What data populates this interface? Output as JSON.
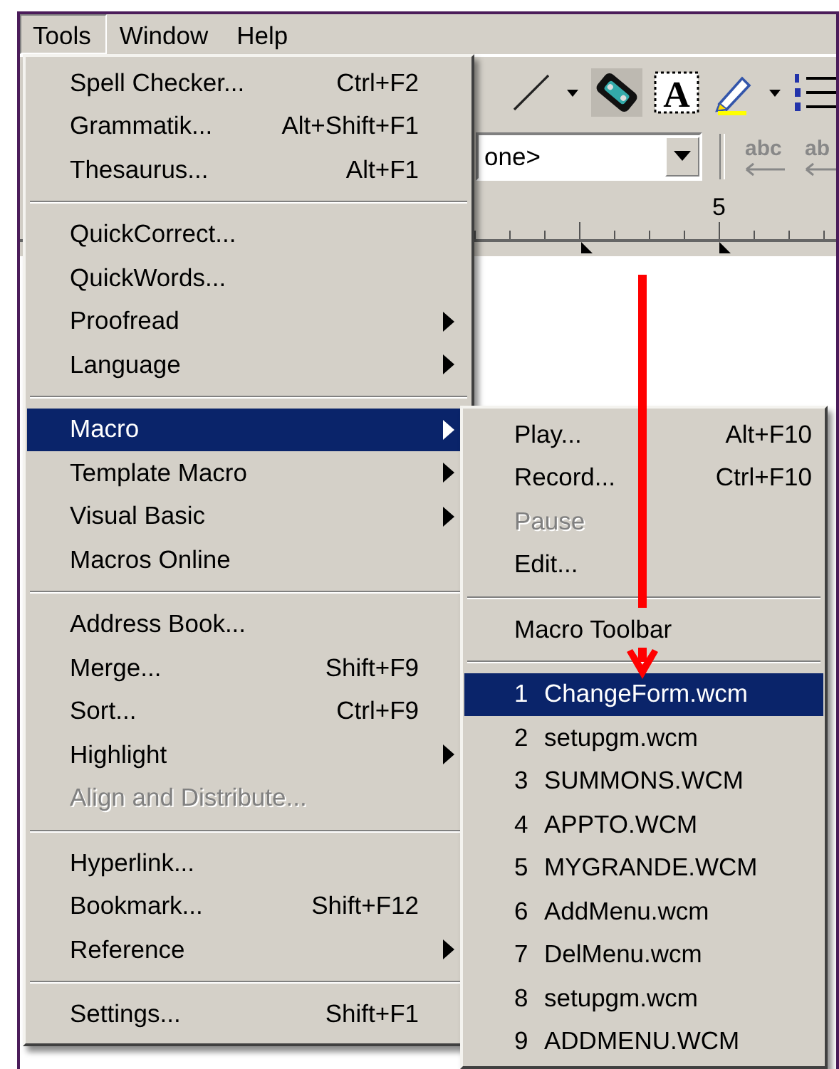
{
  "menubar": [
    {
      "label": "Tools",
      "selected": true
    },
    {
      "label": "Window",
      "selected": false
    },
    {
      "label": "Help",
      "selected": false
    }
  ],
  "toolbar": {
    "text_box_glyph": "A",
    "combo_value": "one>",
    "icon_labels": [
      "abc",
      "ab"
    ]
  },
  "ruler": {
    "labels": [
      "5"
    ]
  },
  "tools_menu": {
    "items": [
      {
        "kind": "item",
        "label": "Spell Checker...",
        "shortcut": "Ctrl+F2",
        "submenu": false,
        "disabled": false,
        "selected": false
      },
      {
        "kind": "item",
        "label": "Grammatik...",
        "shortcut": "Alt+Shift+F1",
        "submenu": false,
        "disabled": false,
        "selected": false
      },
      {
        "kind": "item",
        "label": "Thesaurus...",
        "shortcut": "Alt+F1",
        "submenu": false,
        "disabled": false,
        "selected": false
      },
      {
        "kind": "separator"
      },
      {
        "kind": "item",
        "label": "QuickCorrect...",
        "submenu": false,
        "disabled": false,
        "selected": false
      },
      {
        "kind": "item",
        "label": "QuickWords...",
        "submenu": false,
        "disabled": false,
        "selected": false
      },
      {
        "kind": "item",
        "label": "Proofread",
        "submenu": true,
        "disabled": false,
        "selected": false
      },
      {
        "kind": "item",
        "label": "Language",
        "submenu": true,
        "disabled": false,
        "selected": false
      },
      {
        "kind": "separator"
      },
      {
        "kind": "item",
        "label": "Macro",
        "submenu": true,
        "disabled": false,
        "selected": true
      },
      {
        "kind": "item",
        "label": "Template Macro",
        "submenu": true,
        "disabled": false,
        "selected": false
      },
      {
        "kind": "item",
        "label": "Visual Basic",
        "submenu": true,
        "disabled": false,
        "selected": false
      },
      {
        "kind": "item",
        "label": "Macros Online",
        "submenu": false,
        "disabled": false,
        "selected": false
      },
      {
        "kind": "separator"
      },
      {
        "kind": "item",
        "label": "Address Book...",
        "submenu": false,
        "disabled": false,
        "selected": false
      },
      {
        "kind": "item",
        "label": "Merge...",
        "shortcut": "Shift+F9",
        "submenu": false,
        "disabled": false,
        "selected": false
      },
      {
        "kind": "item",
        "label": "Sort...",
        "shortcut": "Ctrl+F9",
        "submenu": false,
        "disabled": false,
        "selected": false
      },
      {
        "kind": "item",
        "label": "Highlight",
        "submenu": true,
        "disabled": false,
        "selected": false
      },
      {
        "kind": "item",
        "label": "Align and Distribute...",
        "submenu": false,
        "disabled": true,
        "selected": false
      },
      {
        "kind": "separator"
      },
      {
        "kind": "item",
        "label": "Hyperlink...",
        "submenu": false,
        "disabled": false,
        "selected": false
      },
      {
        "kind": "item",
        "label": "Bookmark...",
        "shortcut": "Shift+F12",
        "submenu": false,
        "disabled": false,
        "selected": false
      },
      {
        "kind": "item",
        "label": "Reference",
        "submenu": true,
        "disabled": false,
        "selected": false
      },
      {
        "kind": "separator"
      },
      {
        "kind": "item",
        "label": "Settings...",
        "shortcut": "Shift+F1",
        "submenu": false,
        "disabled": false,
        "selected": false
      }
    ]
  },
  "macro_submenu": {
    "items": [
      {
        "kind": "item",
        "label": "Play...",
        "shortcut": "Alt+F10",
        "disabled": false,
        "selected": false
      },
      {
        "kind": "item",
        "label": "Record...",
        "shortcut": "Ctrl+F10",
        "disabled": false,
        "selected": false
      },
      {
        "kind": "item",
        "label": "Pause",
        "disabled": true,
        "selected": false
      },
      {
        "kind": "item",
        "label": "Edit...",
        "disabled": false,
        "selected": false
      },
      {
        "kind": "separator"
      },
      {
        "kind": "item",
        "label": "Macro Toolbar",
        "disabled": false,
        "selected": false
      },
      {
        "kind": "separator"
      },
      {
        "kind": "item",
        "number": "1",
        "label": "ChangeForm.wcm",
        "disabled": false,
        "selected": true
      },
      {
        "kind": "item",
        "number": "2",
        "label": "setupgm.wcm",
        "disabled": false,
        "selected": false
      },
      {
        "kind": "item",
        "number": "3",
        "label": "SUMMONS.WCM",
        "disabled": false,
        "selected": false
      },
      {
        "kind": "item",
        "number": "4",
        "label": "APPTO.WCM",
        "disabled": false,
        "selected": false
      },
      {
        "kind": "item",
        "number": "5",
        "label": "MYGRANDE.WCM",
        "disabled": false,
        "selected": false
      },
      {
        "kind": "item",
        "number": "6",
        "label": "AddMenu.wcm",
        "disabled": false,
        "selected": false
      },
      {
        "kind": "item",
        "number": "7",
        "label": "DelMenu.wcm",
        "disabled": false,
        "selected": false
      },
      {
        "kind": "item",
        "number": "8",
        "label": "setupgm.wcm",
        "disabled": false,
        "selected": false
      },
      {
        "kind": "item",
        "number": "9",
        "label": "ADDMENU.WCM",
        "disabled": false,
        "selected": false
      }
    ]
  }
}
